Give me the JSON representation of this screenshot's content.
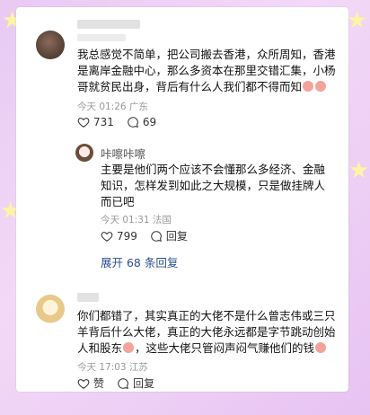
{
  "comment1": {
    "text": "我总感觉不简单，把公司搬去香港，众所周知，香港是离岸金融中心，那么多资本在那里交错汇集，小杨哥就贫民出身，背后有什么人我们都不得而知",
    "time": "今天 01:26 广东",
    "likes": "731",
    "comments": "69"
  },
  "reply1": {
    "author": "咔嚓咔嚓",
    "text": "主要是他们两个应该不会懂那么多经济、金融知识，怎样发到如此之大规模，只是做挂牌人而已吧",
    "time": "今天 01:31 法国",
    "likes": "799",
    "reply_label": "回复"
  },
  "expand_label": "展开 68 条回复",
  "comment2": {
    "text": "你们都错了，其实真正的大佬不是什么曾志伟或三只羊背后什么大佬，真正的大佬永远都是字节跳动创始人和股东",
    "text_tail": "，这些大佬只管闷声闷气赚他们的钱",
    "time": "今天 17:03 江苏",
    "like_label": "赞",
    "reply_label": "回复"
  }
}
